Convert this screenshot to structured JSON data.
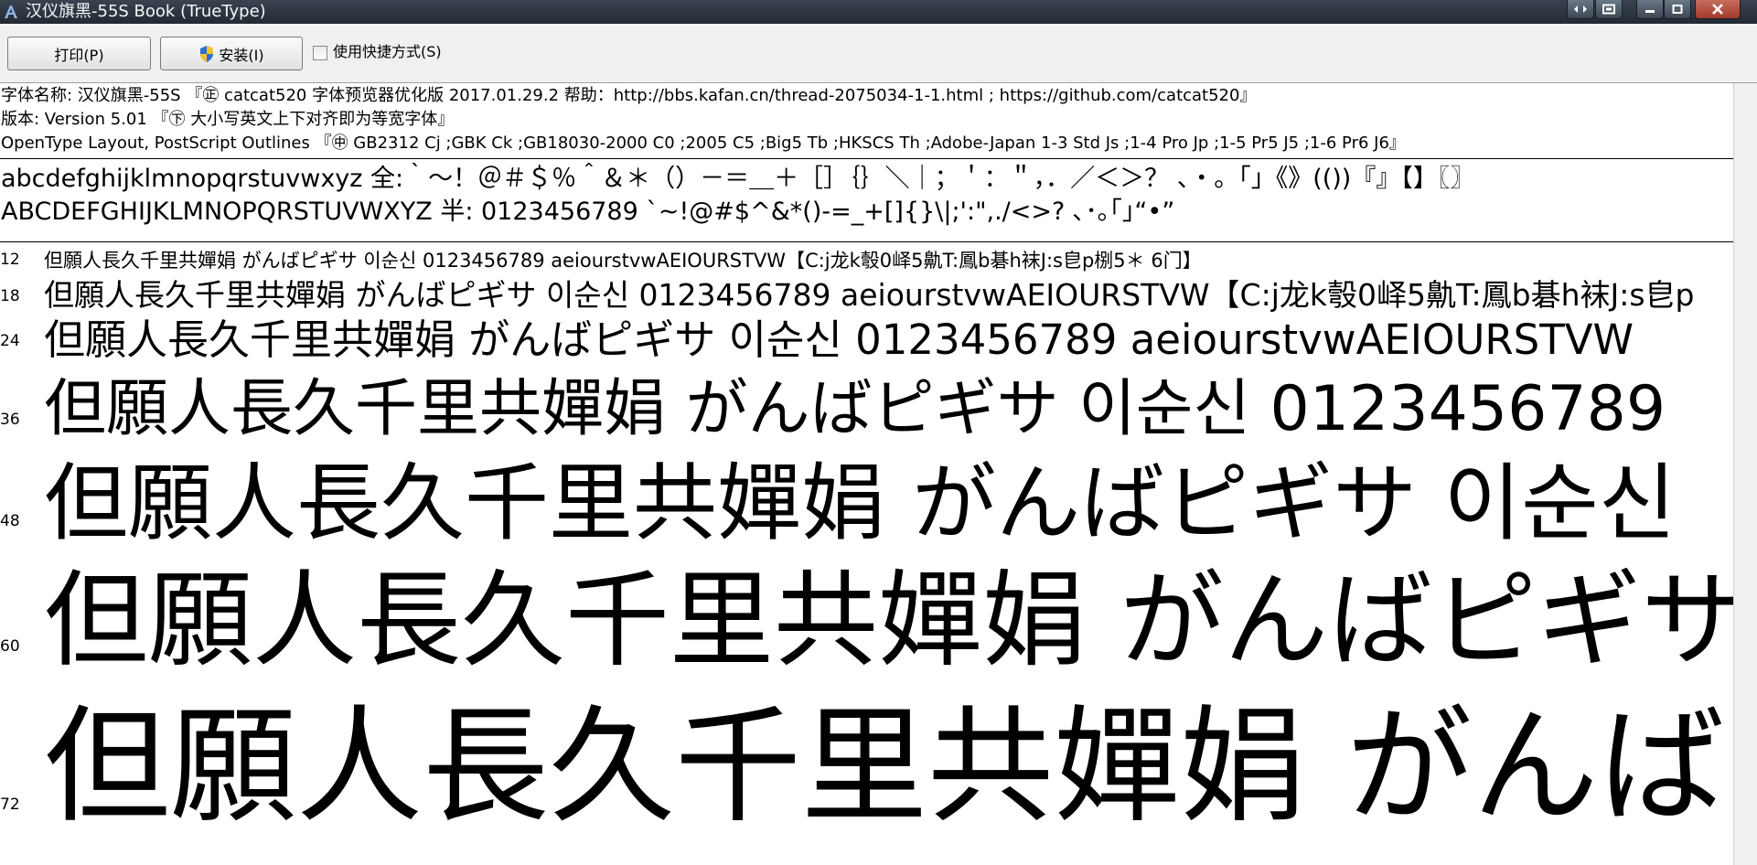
{
  "window": {
    "title": "汉仪旗黑-55S Book (TrueType)",
    "icons": [
      "app-font-icon",
      "restore-toggle-icon",
      "snap-icon",
      "minimize-icon",
      "maximize-icon",
      "close-icon"
    ]
  },
  "toolbar": {
    "print_label": "打印(P)",
    "install_label": "安装(I)",
    "shortcut_label": "使用快捷方式(S)",
    "shortcut_checked": false
  },
  "info": {
    "line1": "字体名称: 汉仪旗黑-55S 『㊣ catcat520 字体预览器优化版 2017.01.29.2 帮助：http://bbs.kafan.cn/thread-2075034-1-1.html ; https://github.com/catcat520』",
    "line2": "版本: Version 5.01 『㊦ 大小写英文上下对齐即为等宽字体』",
    "line3": "OpenType Layout, PostScript Outlines 『㊥ GB2312 Cj ;GBK Ck ;GB18030-2000 C0 ;2005 C5 ;Big5 Tb ;HKSCS Th ;Adobe-Japan 1-3 Std Js ;1-4 Pro Jp ;1-5 Pr5 J5 ;1-6 Pr6 J6』"
  },
  "charset": {
    "line1": "abcdefghijklmnopqrstuvwxyz 全:｀～！＠＃＄％＾＆＊（）－＝＿＋［］｛｝＼｜；＇：＂，．／＜＞？ 、・。「」《》(())『』【】〖〗",
    "line2": "ABCDEFGHIJKLMNOPQRSTUVWXYZ 半: 0123456789 `~!@#$^&*()-=_+[]{}\\|;':\",./<>? ､･｡｢｣“•”"
  },
  "samples": [
    {
      "size": "12",
      "text": "但願人長久千里共嬋娟 がんばピギサ 이순신 0123456789 aeiourstvwAEIOURSTVW【C:j龙k彀0峄5鼽T:鳳b碁h袜J:s皀p㭭5＊ 6门】"
    },
    {
      "size": "18",
      "text": "但願人長久千里共嬋娟 がんばピギサ 이순신 0123456789 aeiourstvwAEIOURSTVW【C:j龙k彀0峄5鼽T:鳳b碁h袜J:s皀p"
    },
    {
      "size": "24",
      "text": "但願人長久千里共嬋娟 がんばピギサ 이순신 0123456789 aeiourstvwAEIOURSTVW"
    },
    {
      "size": "36",
      "text": "但願人長久千里共嬋娟 がんばピギサ 이순신 0123456789"
    },
    {
      "size": "48",
      "text": "但願人長久千里共嬋娟 がんばピギサ 이순신"
    },
    {
      "size": "60",
      "text": "但願人長久千里共嬋娟 がんばピギサ"
    },
    {
      "size": "72",
      "text": "但願人長久千里共嬋娟 がんば"
    }
  ]
}
